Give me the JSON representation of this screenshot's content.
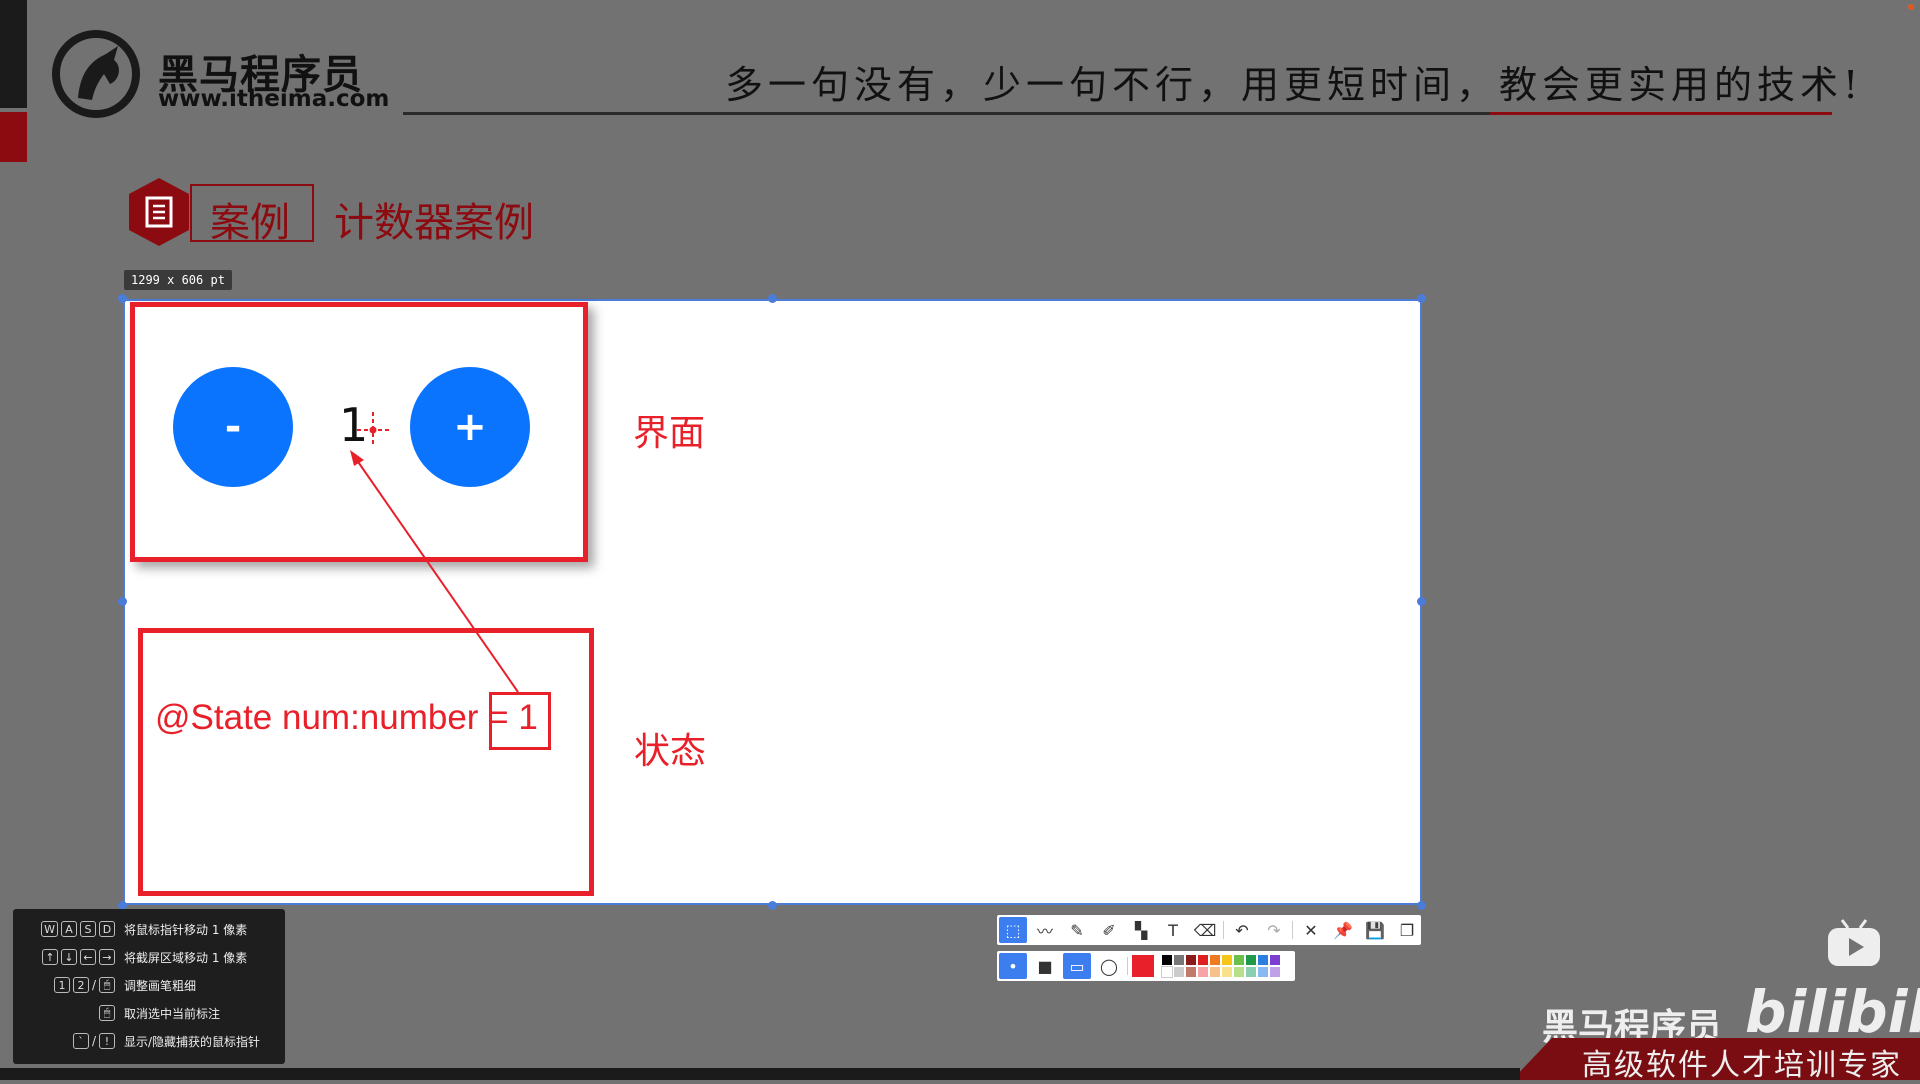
{
  "header": {
    "brand_title": "黑马程序员",
    "brand_url": "www.itheima.com",
    "slogan": "多一句没有，少一句不行，用更短时间，教会更实用的技术!"
  },
  "section": {
    "tag": "案例",
    "title": "计数器案例"
  },
  "capture": {
    "size_badge": "1299 x 606  pt"
  },
  "slide": {
    "minus_label": "-",
    "plus_label": "+",
    "count_value": "1",
    "ui_label": "界面",
    "state_code": "@State num:number = 1",
    "state_label": "状态"
  },
  "shortcuts": [
    {
      "keys": [
        "W",
        "A",
        "S",
        "D"
      ],
      "text": "将鼠标指针移动 1 像素"
    },
    {
      "keys": [
        "↑",
        "↓",
        "←",
        "→"
      ],
      "text": "将截屏区域移动 1 像素"
    },
    {
      "keys": [
        "1",
        "2",
        "/",
        "🖱"
      ],
      "text": "调整画笔粗细"
    },
    {
      "keys": [
        "🖱"
      ],
      "text": "取消选中当前标注"
    },
    {
      "keys": [
        "`",
        "/",
        "!"
      ],
      "text": "显示/隐藏捕获的鼠标指针"
    }
  ],
  "toolbar": {
    "row1_icons": [
      "select-icon",
      "polyline-icon",
      "pen-icon",
      "marker-icon",
      "mosaic-icon",
      "text-icon",
      "eraser-icon",
      "undo-icon",
      "redo-icon",
      "close-icon",
      "pin-icon",
      "save-icon",
      "copy-icon"
    ],
    "swatch_colors": [
      "#000000",
      "#777777",
      "#8b1a1a",
      "#e02020",
      "#f07a20",
      "#f5c518",
      "#6ac04a",
      "#1e9a4a",
      "#2a7fe0",
      "#7a3fd0",
      "#ffffff",
      "#cccccc",
      "#c27a6a",
      "#f5a5a5",
      "#f7c28a",
      "#f7e28a",
      "#b8e08a",
      "#8ad0b0",
      "#8ab8f0",
      "#c0a0e8"
    ],
    "current_color": "#e8202a"
  },
  "watermark": {
    "brand": "黑马程序员",
    "bilibili": "bilibili",
    "slogan": "高级软件人才培训专家"
  },
  "colors": {
    "accent_red": "#e8202a",
    "button_blue": "#0a74ff",
    "selection_blue": "#4a7cd8",
    "brand_dark_red": "#8c0b10"
  }
}
